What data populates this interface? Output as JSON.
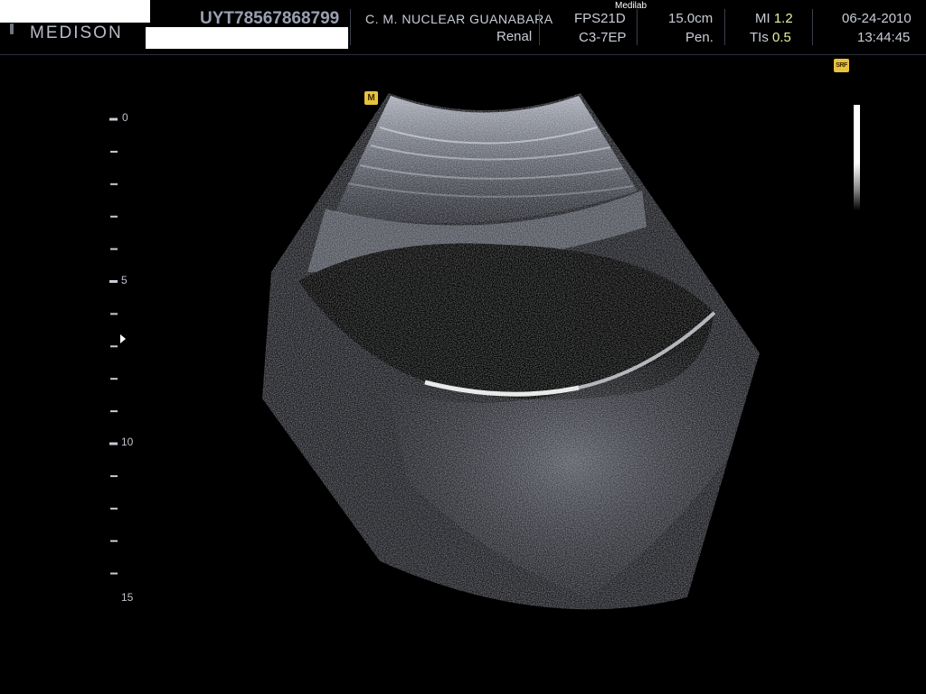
{
  "header": {
    "brand": "MEDISON",
    "patient_id": "UYT78567868799",
    "hospital": "C. M. NUCLEAR  GUANABARA",
    "exam": "Renal",
    "preset_label": "Medilab",
    "frame_rate": "FPS21D",
    "probe": "C3-7EP",
    "depth": "15.0cm",
    "penetration": "Pen.",
    "mi_label": "MI",
    "mi_value": "1.2",
    "tis_label": "TIs",
    "tis_value": "0.5",
    "date": "06-24-2010",
    "time": "13:44:45"
  },
  "scale": {
    "label_0": "0",
    "label_5": "5",
    "label_10": "10",
    "label_15": "15"
  },
  "tags": {
    "m": "M",
    "srf": "SRF"
  },
  "colors": {
    "background": "#000000",
    "header_text": "#c9cdd6",
    "value_highlight": "#e8f0a0",
    "tag_yellow": "#e8c23c"
  }
}
